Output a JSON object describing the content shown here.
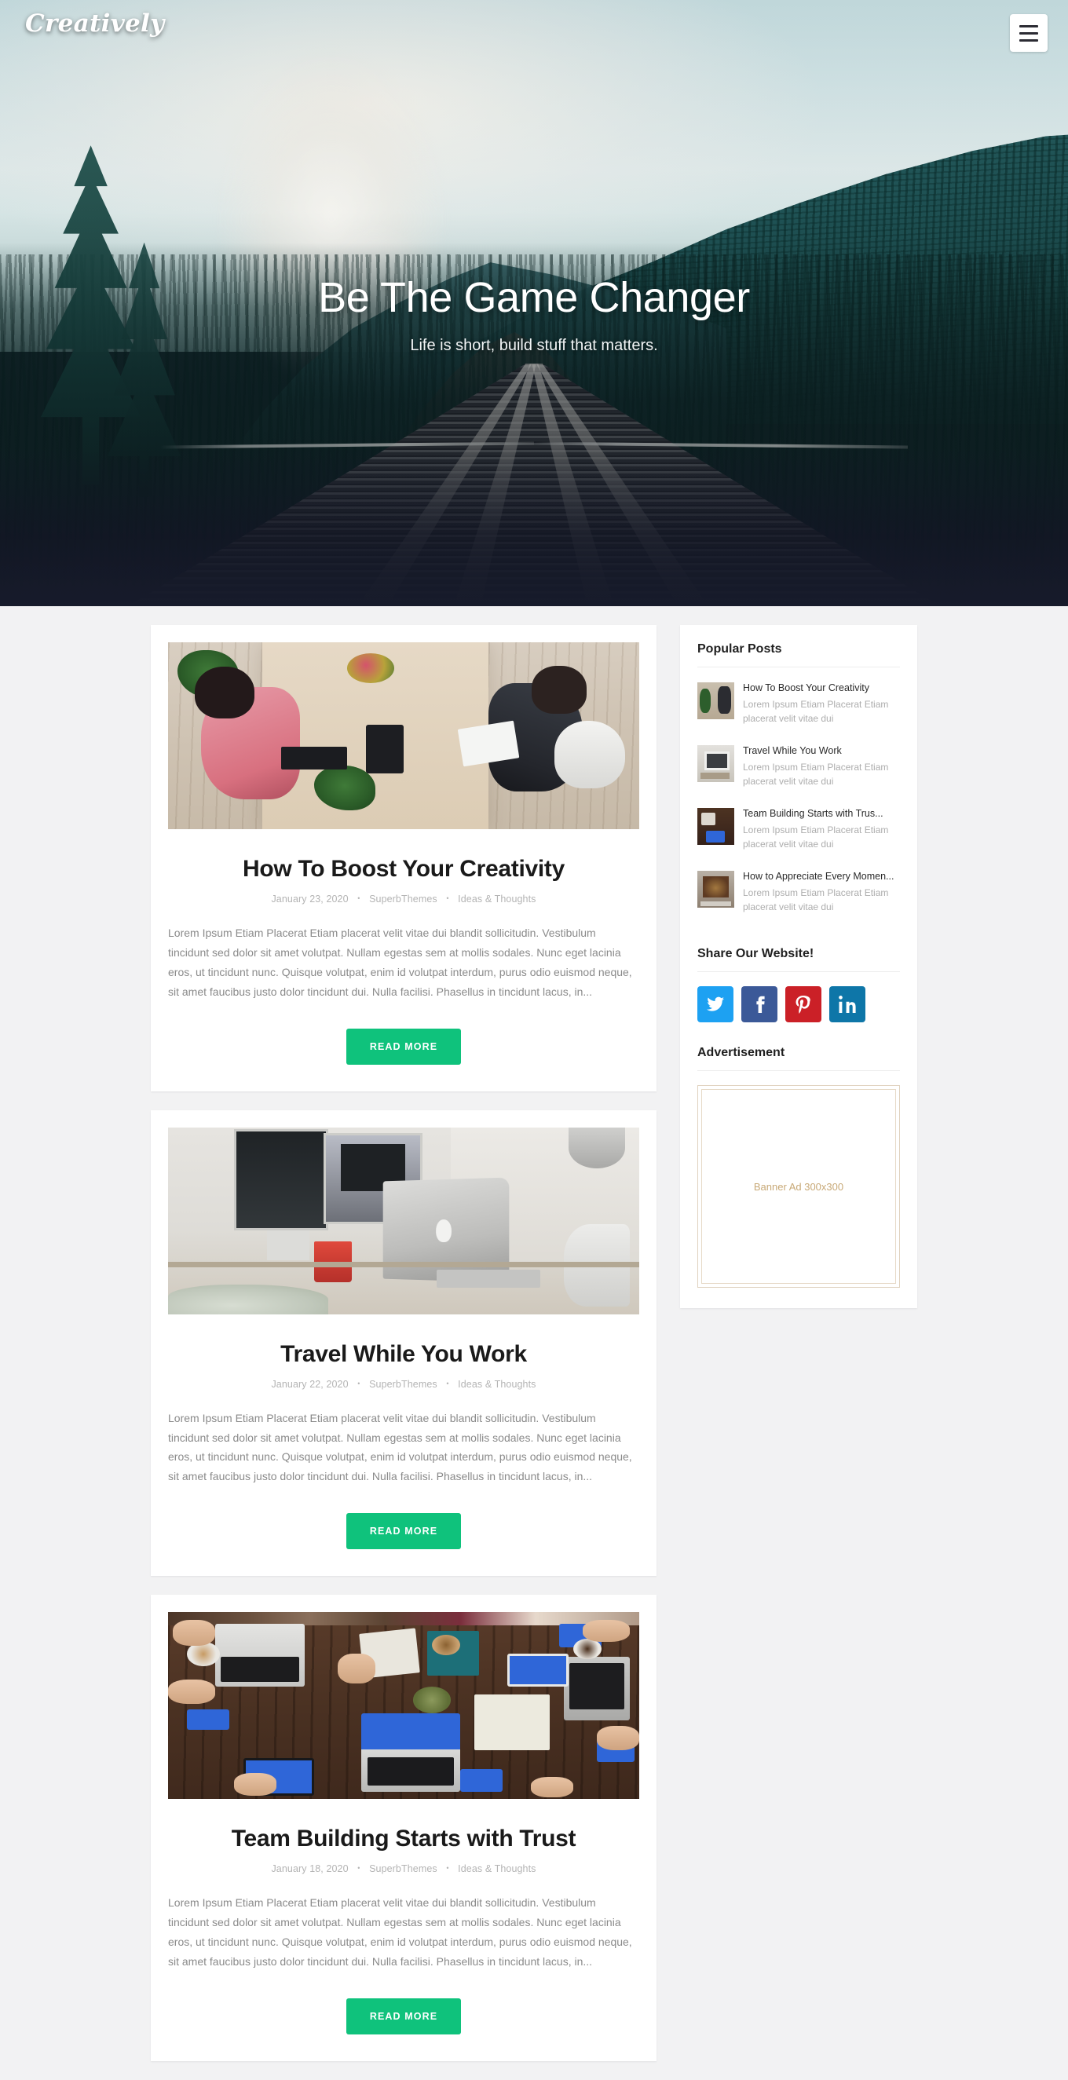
{
  "header": {
    "logo": "Creatively",
    "menu_icon": "hamburger-menu-icon"
  },
  "hero": {
    "title": "Be The Game Changer",
    "subtitle": "Life is short, build stuff that matters."
  },
  "posts": [
    {
      "title": "How To Boost Your Creativity",
      "date": "January 23, 2020",
      "author": "SuperbThemes",
      "category": "Ideas & Thoughts",
      "excerpt": "Lorem Ipsum Etiam Placerat Etiam placerat velit vitae dui blandit sollicitudin. Vestibulum tincidunt sed dolor sit amet volutpat. Nullam egestas sem at mollis sodales. Nunc eget lacinia eros, ut tincidunt nunc. Quisque volutpat, enim id volutpat interdum, purus odio euismod neque, sit amet faucibus justo dolor tincidunt dui. Nulla facilisi. Phasellus in tincidunt lacus, in...",
      "read_more": "READ MORE"
    },
    {
      "title": "Travel While You Work",
      "date": "January 22, 2020",
      "author": "SuperbThemes",
      "category": "Ideas & Thoughts",
      "excerpt": "Lorem Ipsum Etiam Placerat Etiam placerat velit vitae dui blandit sollicitudin. Vestibulum tincidunt sed dolor sit amet volutpat. Nullam egestas sem at mollis sodales. Nunc eget lacinia eros, ut tincidunt nunc. Quisque volutpat, enim id volutpat interdum, purus odio euismod neque, sit amet faucibus justo dolor tincidunt dui. Nulla facilisi. Phasellus in tincidunt lacus, in...",
      "read_more": "READ MORE"
    },
    {
      "title": "Team Building Starts with Trust",
      "date": "January 18, 2020",
      "author": "SuperbThemes",
      "category": "Ideas & Thoughts",
      "excerpt": "Lorem Ipsum Etiam Placerat Etiam placerat velit vitae dui blandit sollicitudin. Vestibulum tincidunt sed dolor sit amet volutpat. Nullam egestas sem at mollis sodales. Nunc eget lacinia eros, ut tincidunt nunc. Quisque volutpat, enim id volutpat interdum, purus odio euismod neque, sit amet faucibus justo dolor tincidunt dui. Nulla facilisi. Phasellus in tincidunt lacus, in...",
      "read_more": "READ MORE"
    }
  ],
  "meta_separator": "•",
  "sidebar": {
    "popular_posts": {
      "title": "Popular Posts",
      "items": [
        {
          "title": "How To Boost Your Creativity",
          "desc": "Lorem Ipsum Etiam Placerat Etiam placerat velit vitae dui"
        },
        {
          "title": "Travel While You Work",
          "desc": "Lorem Ipsum Etiam Placerat Etiam placerat velit vitae dui"
        },
        {
          "title": "Team Building Starts with Trus...",
          "desc": "Lorem Ipsum Etiam Placerat Etiam placerat velit vitae dui"
        },
        {
          "title": "How to Appreciate Every Momen...",
          "desc": "Lorem Ipsum Etiam Placerat Etiam placerat velit vitae dui"
        }
      ]
    },
    "share": {
      "title": "Share Our Website!",
      "buttons": [
        {
          "name": "twitter",
          "color": "#1da1f2"
        },
        {
          "name": "facebook",
          "color": "#3b5998"
        },
        {
          "name": "pinterest",
          "color": "#cb2027"
        },
        {
          "name": "linkedin",
          "color": "#0e76a8"
        }
      ]
    },
    "advertisement": {
      "title": "Advertisement",
      "placeholder": "Banner Ad 300x300"
    }
  },
  "colors": {
    "accent_green": "#0fc27c",
    "page_bg": "#f2f2f3",
    "hero_dark": "#1b1f30"
  }
}
